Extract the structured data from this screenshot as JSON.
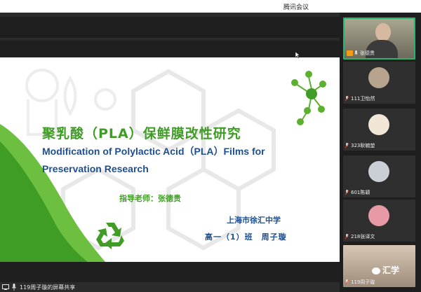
{
  "window": {
    "title": "腾讯会议"
  },
  "slide": {
    "title_cn": "聚乳酸（PLA）保鲜膜改性研究",
    "title_en": "Modification of Polylactic Acid（PLA）Films for Preservation Research",
    "advisor": "指导老师：张德贵",
    "school": "上海市徐汇中学",
    "class_author": "高一（1）班　周子璇",
    "colors": {
      "green": "#3f9c25",
      "blue": "#1f4f8f"
    }
  },
  "share_bar": {
    "label": "119周子璇的屏幕共享",
    "icons": [
      "screen-share-icon",
      "mic-icon"
    ]
  },
  "participants": [
    {
      "name": "张德贵",
      "icon": "mic-icon",
      "active": true
    },
    {
      "name": "111卫怡然",
      "icon": "mic-muted-icon"
    },
    {
      "name": "323耿毓堃",
      "icon": "mic-muted-icon"
    },
    {
      "name": "601陈颖",
      "icon": "mic-muted-icon"
    },
    {
      "name": "218张译文",
      "icon": "mic-muted-icon"
    },
    {
      "name": "119周子璇",
      "icon": "mic-muted-icon"
    }
  ],
  "watermark": {
    "text": "汇学"
  },
  "accent": "#29b36b"
}
